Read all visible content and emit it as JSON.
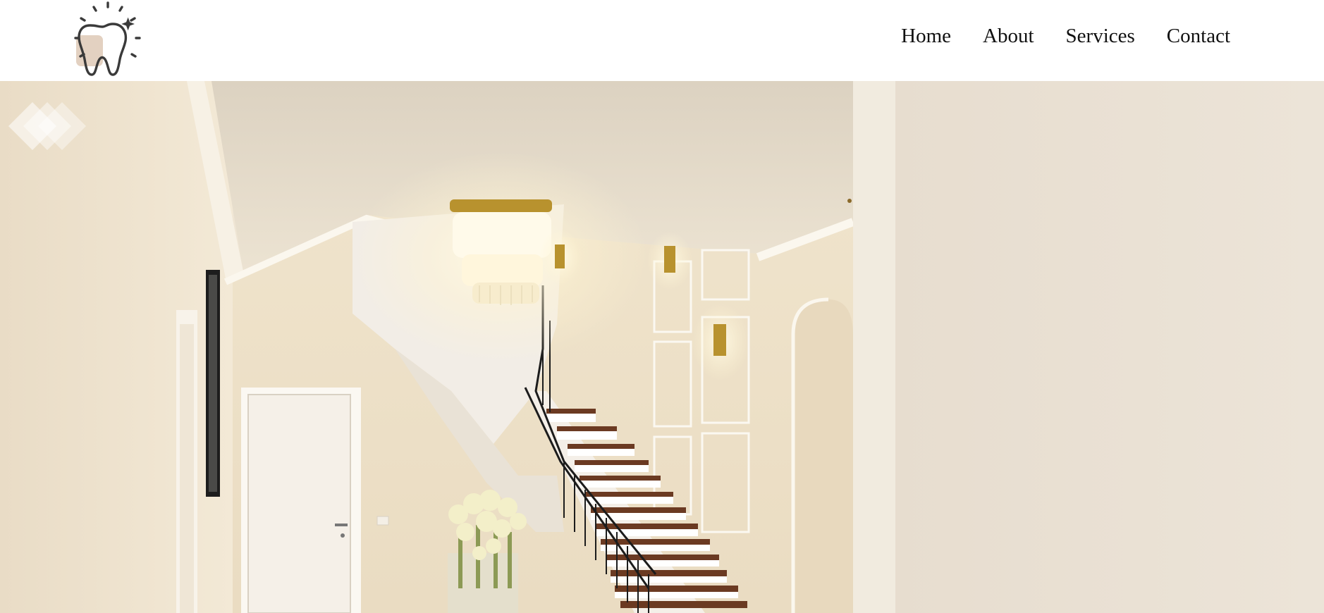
{
  "brand": {
    "logo_icon": "tooth-sparkle-icon",
    "logo_accent": "#e3d1c1",
    "logo_stroke": "#3a3a3a"
  },
  "nav": {
    "items": [
      {
        "label": "Home"
      },
      {
        "label": "About"
      },
      {
        "label": "Services"
      },
      {
        "label": "Contact"
      }
    ]
  },
  "hero": {
    "media": "interior-staircase-chandelier-video",
    "badge_icon": "diamond-layers-icon",
    "colors": {
      "wall": "#efe4d1",
      "ceiling": "#e6dcca",
      "panel": "#ebe1cf",
      "right_wall": "#ece3d6",
      "stair_wood": "#6b3a22",
      "brass": "#b8922e"
    }
  }
}
